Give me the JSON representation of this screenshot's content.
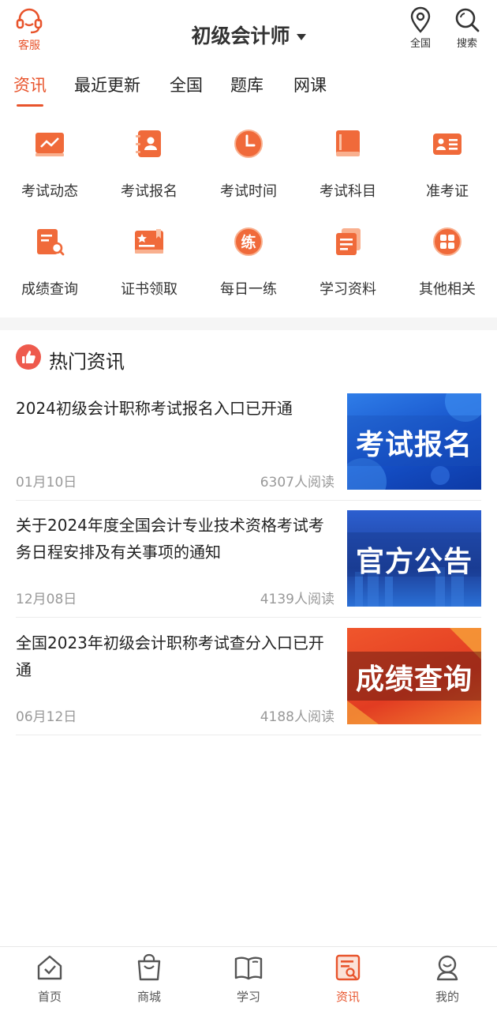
{
  "header": {
    "service_label": "客服",
    "title": "初级会计师",
    "location_label": "全国",
    "search_label": "搜索"
  },
  "tabs": [
    {
      "label": "资讯",
      "active": true
    },
    {
      "label": "最近更新"
    },
    {
      "label": "全国"
    },
    {
      "label": "题库"
    },
    {
      "label": "网课"
    }
  ],
  "quick_links": [
    {
      "label": "考试动态",
      "icon": "trend-chart-icon"
    },
    {
      "label": "考试报名",
      "icon": "registration-book-icon"
    },
    {
      "label": "考试时间",
      "icon": "clock-icon"
    },
    {
      "label": "考试科目",
      "icon": "subject-book-icon"
    },
    {
      "label": "准考证",
      "icon": "admission-card-icon"
    },
    {
      "label": "成绩查询",
      "icon": "score-search-icon"
    },
    {
      "label": "证书领取",
      "icon": "certificate-icon"
    },
    {
      "label": "每日一练",
      "icon": "daily-practice-icon",
      "glyph": "练"
    },
    {
      "label": "学习资料",
      "icon": "study-material-icon"
    },
    {
      "label": "其他相关",
      "icon": "grid-apps-icon"
    }
  ],
  "hot_news": {
    "title": "热门资讯",
    "items": [
      {
        "title": "2024初级会计职称考试报名入口已开通",
        "date": "01月10日",
        "reads": "6307人阅读",
        "thumb_text": "考试报名"
      },
      {
        "title": "关于2024年度全国会计专业技术资格考试考务日程安排及有关事项的通知",
        "date": "12月08日",
        "reads": "4139人阅读",
        "thumb_text": "官方公告"
      },
      {
        "title": "全国2023年初级会计职称考试查分入口已开通",
        "date": "06月12日",
        "reads": "4188人阅读",
        "thumb_text": "成绩查询"
      }
    ]
  },
  "bottom_nav": [
    {
      "label": "首页",
      "icon": "home-icon"
    },
    {
      "label": "商城",
      "icon": "shopping-bag-icon"
    },
    {
      "label": "学习",
      "icon": "open-book-icon"
    },
    {
      "label": "资讯",
      "icon": "news-icon",
      "active": true
    },
    {
      "label": "我的",
      "icon": "profile-icon"
    }
  ],
  "colors": {
    "accent": "#e8542c",
    "icon_orange": "#f06a3a",
    "text": "#222222",
    "muted": "#999999"
  }
}
